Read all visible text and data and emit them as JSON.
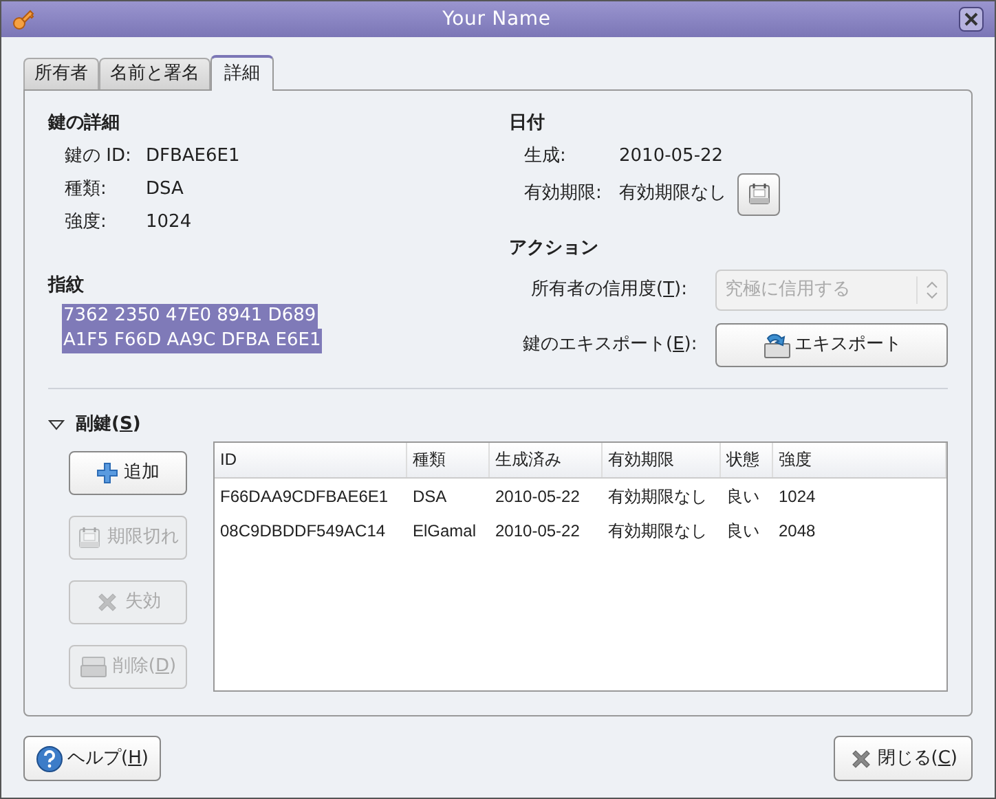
{
  "window": {
    "title": "Your Name"
  },
  "tabs": [
    {
      "label": "所有者",
      "selected": false
    },
    {
      "label": "名前と署名",
      "selected": false
    },
    {
      "label": "詳細",
      "selected": true
    }
  ],
  "key_details": {
    "heading": "鍵の詳細",
    "rows": [
      {
        "label": "鍵の ID:",
        "value": "DFBAE6E1"
      },
      {
        "label": "種類:",
        "value": "DSA"
      },
      {
        "label": "強度:",
        "value": "1024"
      }
    ]
  },
  "fingerprint": {
    "heading": "指紋",
    "lines": [
      "7362 2350 47E0 8941 D689",
      "A1F5 F66D AA9C DFBA E6E1"
    ]
  },
  "dates": {
    "heading": "日付",
    "created_label": "生成:",
    "created": "2010-05-22",
    "expires_label": "有効期限:",
    "expires": "有効期限なし"
  },
  "actions": {
    "heading": "アクション",
    "trust_label": "所有者の信用度(T):",
    "trust": {
      "value": "究極に信用する",
      "disabled": true
    },
    "export_label": "鍵のエキスポート(E):",
    "export_button": "エキスポート"
  },
  "subkeys": {
    "heading": "副鍵(S)",
    "expanded": true,
    "buttons": [
      {
        "kind": "add",
        "label": "追加",
        "disabled": false
      },
      {
        "kind": "expire",
        "label": "期限切れ",
        "disabled": true
      },
      {
        "kind": "revoke",
        "label": "失効",
        "disabled": true
      },
      {
        "kind": "delete",
        "label": "削除(D)",
        "disabled": true
      }
    ],
    "columns": [
      "ID",
      "種類",
      "生成済み",
      "有効期限",
      "状態",
      "強度"
    ],
    "rows": [
      [
        "F66DAA9CDFBAE6E1",
        "DSA",
        "2010-05-22",
        "有効期限なし",
        "良い",
        "1024"
      ],
      [
        "08C9DBDDF549AC14",
        "ElGamal",
        "2010-05-22",
        "有効期限なし",
        "良い",
        "2048"
      ]
    ]
  },
  "footer": {
    "help": "ヘルプ(H)",
    "close": "閉じる(C)"
  }
}
